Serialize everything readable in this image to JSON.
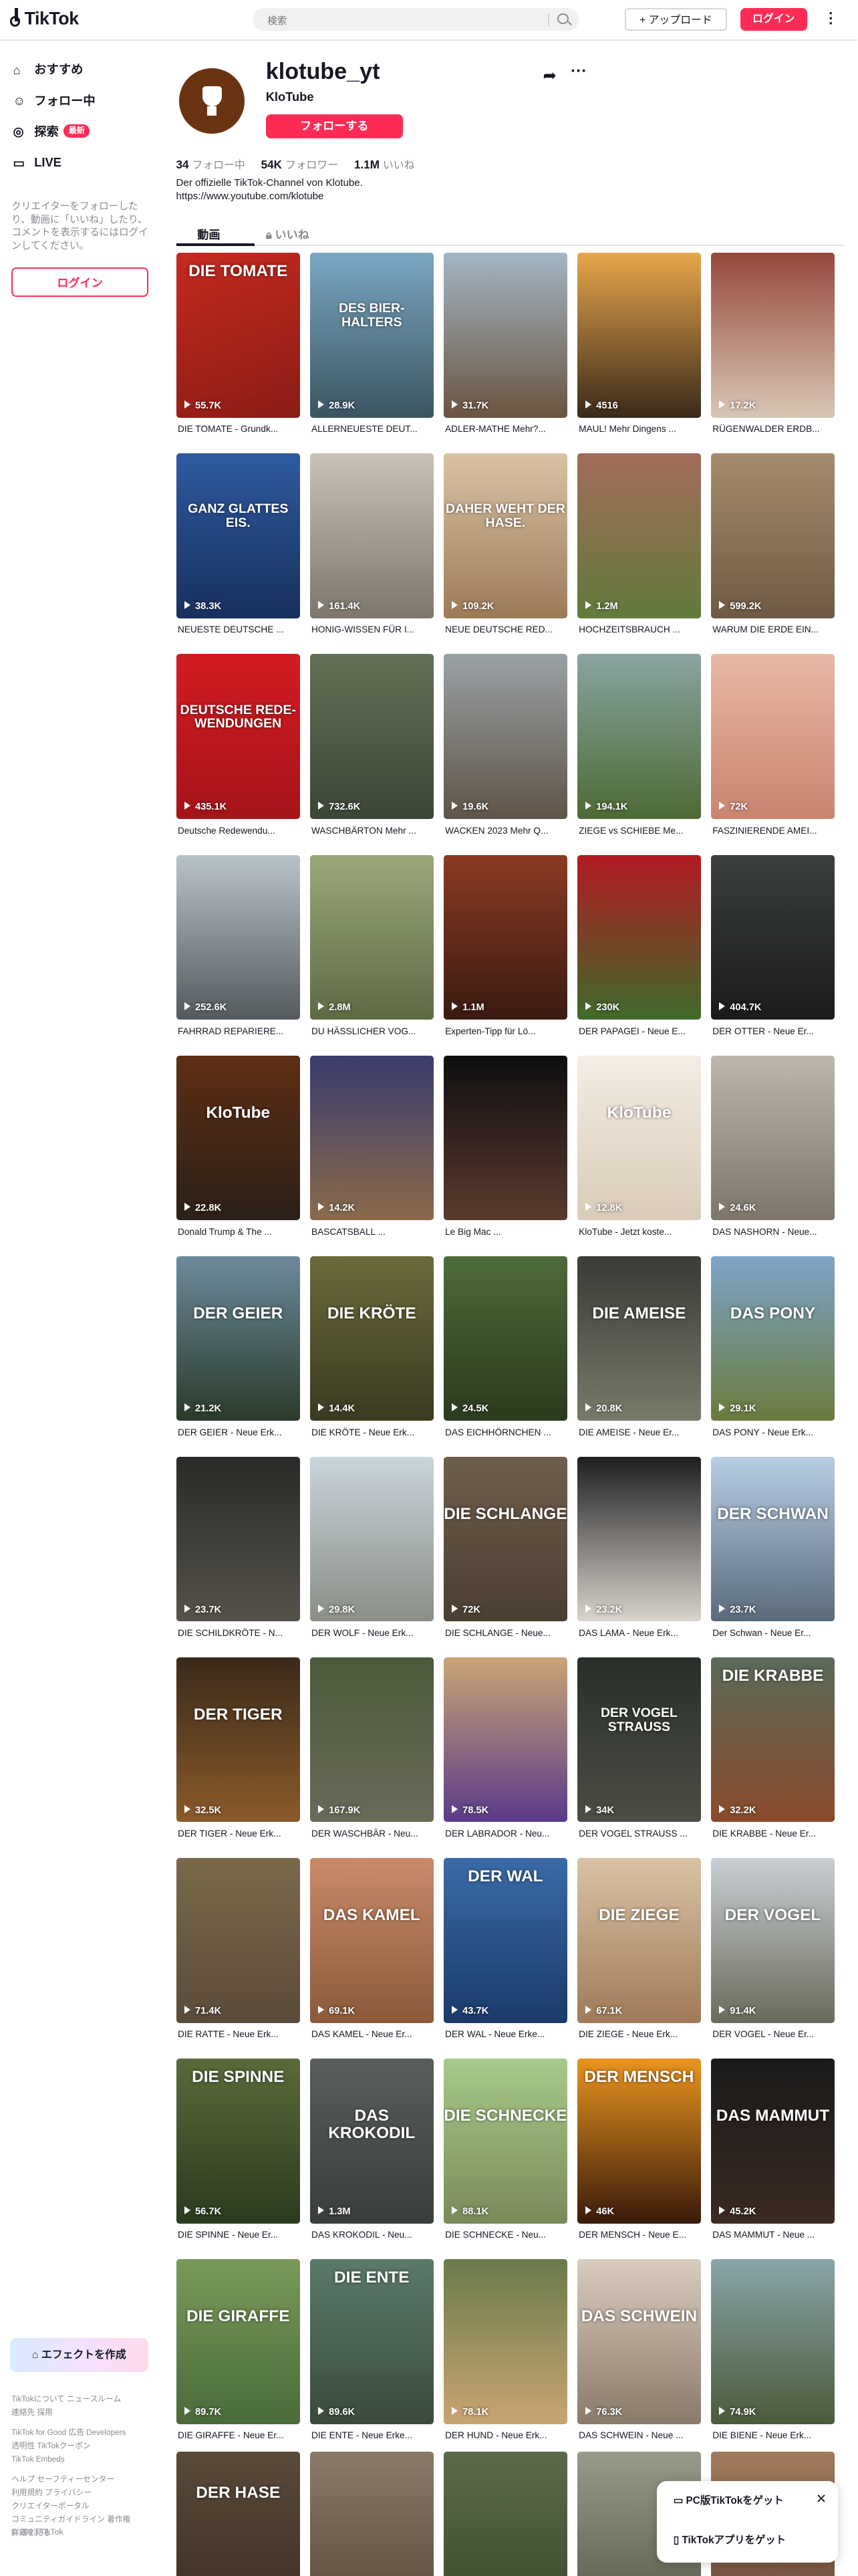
{
  "header": {
    "logo": "TikTok",
    "search_placeholder": "検索",
    "upload_label": "アップロード",
    "login_label": "ログイン"
  },
  "sidebar": {
    "items": [
      {
        "label": "おすすめ",
        "icon": "home-icon"
      },
      {
        "label": "フォロー中",
        "icon": "following-icon"
      },
      {
        "label": "探索",
        "icon": "compass-icon",
        "badge": "最新"
      },
      {
        "label": "LIVE",
        "icon": "live-icon"
      }
    ],
    "login_prompt": "クリエイターをフォローしたり、動画に「いいね」したり、コメントを表示するにはログインしてください。",
    "login_button": "ログイン",
    "effect_button": "エフェクトを作成",
    "footer_links": [
      "TikTokについて  ニュースルーム",
      "連絡先  採用",
      "TikTok for Good  広告  Developers",
      "透明性  TikTokクーポン",
      "TikTok Embeds",
      "ヘルプ  セーフティーセンター",
      "利用規約  プライバシー",
      "クリエイターポータル",
      "コミュニティガイドライン  著作権",
      "詳細を見る"
    ],
    "copyright": "© 2023 TikTok"
  },
  "profile": {
    "username": "klotube_yt",
    "nickname": "KloTube",
    "follow_button": "フォローする",
    "following_count": "34",
    "following_label": "フォロー中",
    "followers_count": "54K",
    "followers_label": "フォロワー",
    "likes_count": "1.1M",
    "likes_label": "いいね",
    "bio_line1": "Der offizielle TikTok-Channel von Klotube.",
    "bio_line2": "https://www.youtube.com/klotube",
    "tab_videos": "動画",
    "tab_likes": "いいね"
  },
  "videos": [
    {
      "views": "55.7K",
      "caption": "DIE TOMATE - Grundk...",
      "overlay": "DIE TOMATE",
      "bg": "linear-gradient(160deg,#c52a20,#8a1c15)"
    },
    {
      "views": "28.9K",
      "caption": "ALLERNEUESTE DEUT...",
      "overlay": "DES BIER-HALTERS",
      "bg": "linear-gradient(180deg,#7aa7c3,#3b5560)"
    },
    {
      "views": "31.7K",
      "caption": "ADLER-MATHE Mehr?...",
      "overlay": "",
      "bg": "linear-gradient(180deg,#a3b6c4,#6a5440)"
    },
    {
      "views": "4516",
      "caption": "MAUL! Mehr Dingens ...",
      "overlay": "",
      "bg": "linear-gradient(180deg,#e8a64b,#3a2a1a)"
    },
    {
      "views": "17.2K",
      "caption": "RÜGENWALDER ERDB...",
      "overlay": "",
      "bg": "linear-gradient(180deg,#96483c,#d9c7b6)"
    },
    {
      "views": "38.3K",
      "caption": "NEUESTE DEUTSCHE ...",
      "overlay": "GANZ GLATTES EIS.",
      "bg": "linear-gradient(180deg,#2e5aa0,#17305e)"
    },
    {
      "views": "161.4K",
      "caption": "HONIG-WISSEN FÜR I...",
      "overlay": "",
      "bg": "linear-gradient(180deg,#c9c2b6,#7c766c)"
    },
    {
      "views": "109.2K",
      "caption": "NEUE DEUTSCHE RED...",
      "overlay": "DAHER WEHT DER HASE.",
      "bg": "linear-gradient(180deg,#d9c3a4,#9c7a58)"
    },
    {
      "views": "1.2M",
      "caption": "HOCHZEITSBRAUCH ...",
      "overlay": "",
      "bg": "linear-gradient(180deg,#a36c5a,#617a3c)"
    },
    {
      "views": "599.2K",
      "caption": "WARUM DIE ERDE EIN...",
      "overlay": "",
      "bg": "linear-gradient(180deg,#a58c6c,#6e5a44)"
    },
    {
      "views": "435.1K",
      "caption": "Deutsche Redewendu...",
      "overlay": "DEUTSCHE REDE-WENDUNGEN",
      "bg": "linear-gradient(180deg,#d31c22,#a5141a)"
    },
    {
      "views": "732.6K",
      "caption": "WASCHBÄRTON Mehr ...",
      "overlay": "",
      "bg": "linear-gradient(180deg,#627056,#3c4636)"
    },
    {
      "views": "19.6K",
      "caption": "WACKEN 2023 Mehr Q...",
      "overlay": "",
      "bg": "linear-gradient(180deg,#9aa1a5,#5f5448)"
    },
    {
      "views": "194.1K",
      "caption": "ZIEGE vs SCHIEBE Me...",
      "overlay": "",
      "bg": "linear-gradient(180deg,#8aa4a0,#4d6a34)"
    },
    {
      "views": "72K",
      "caption": "FASZINIERENDE AMEI...",
      "overlay": "",
      "bg": "linear-gradient(180deg,#e8b8a6,#c9846e)"
    },
    {
      "views": "252.6K",
      "caption": "FAHRRAD REPARIERE...",
      "overlay": "",
      "bg": "linear-gradient(180deg,#b8c3c9,#545a5e)"
    },
    {
      "views": "2.8M",
      "caption": "DU HÄSSLICHER VOG...",
      "overlay": "",
      "bg": "linear-gradient(180deg,#9aa87a,#5e6a44)"
    },
    {
      "views": "1.1M",
      "caption": "Experten-Tipp für Lö...",
      "overlay": "",
      "bg": "linear-gradient(180deg,#8b3a22,#3a1a12)"
    },
    {
      "views": "230K",
      "caption": "DER PAPAGEI - Neue E...",
      "overlay": "",
      "bg": "linear-gradient(180deg,#b31a22,#3f6a2c)"
    },
    {
      "views": "404.7K",
      "caption": "DER OTTER - Neue Er...",
      "overlay": "",
      "bg": "linear-gradient(180deg,#3a3e3c,#1a1c1a)"
    },
    {
      "views": "22.8K",
      "caption": "Donald Trump & The ...",
      "overlay": "KloTube",
      "bg": "linear-gradient(180deg,#5e2e14,#2b2018)"
    },
    {
      "views": "14.2K",
      "caption": "BASCATSBALL ...",
      "overlay": "",
      "bg": "linear-gradient(180deg,#3a3c6e,#8a6a4a)"
    },
    {
      "views": "",
      "caption": "Le Big Mac ...",
      "overlay": "",
      "bg": "linear-gradient(180deg,#0e0e10,#5a3a2e)"
    },
    {
      "views": "12.8K",
      "caption": "KloTube - Jetzt koste...",
      "overlay": "KloTube",
      "bg": "linear-gradient(180deg,#f4ede4,#d9cbb8)"
    },
    {
      "views": "24.6K",
      "caption": "DAS NASHORN - Neue...",
      "overlay": "",
      "bg": "linear-gradient(180deg,#bcb6ac,#7d766a)"
    },
    {
      "views": "21.2K",
      "caption": "DER GEIER - Neue Erk...",
      "overlay": "DER GEIER",
      "bg": "linear-gradient(180deg,#6d8a9c,#2a3a2a)"
    },
    {
      "views": "14.4K",
      "caption": "DIE KRÖTE - Neue Erk...",
      "overlay": "DIE KRÖTE",
      "bg": "linear-gradient(180deg,#6b6a3a,#3a3a22)"
    },
    {
      "views": "24.5K",
      "caption": "DAS EICHHÖRNCHEN ...",
      "overlay": "",
      "bg": "linear-gradient(180deg,#4e6a3a,#2a3a1e)"
    },
    {
      "views": "20.8K",
      "caption": "DIE AMEISE - Neue Er...",
      "overlay": "DIE AMEISE",
      "bg": "linear-gradient(180deg,#3a3a36,#7a7a6a)"
    },
    {
      "views": "29.1K",
      "caption": "DAS PONY - Neue Erk...",
      "overlay": "DAS PONY",
      "bg": "linear-gradient(180deg,#7ea4c9,#6a7a3c)"
    },
    {
      "views": "23.7K",
      "caption": "DIE SCHILDKRÖTE - N...",
      "overlay": "",
      "bg": "linear-gradient(180deg,#2a2a28,#55524a)"
    },
    {
      "views": "29.8K",
      "caption": "DER WOLF - Neue Erk...",
      "overlay": "",
      "bg": "linear-gradient(180deg,#c9d4dc,#8a8e86)"
    },
    {
      "views": "72K",
      "caption": "DIE SCHLANGE - Neue...",
      "overlay": "DIE SCHLANGE",
      "bg": "linear-gradient(180deg,#6e5e4c,#4a3e32)"
    },
    {
      "views": "23.2K",
      "caption": "DAS LAMA - Neue Erk...",
      "overlay": "",
      "bg": "linear-gradient(180deg,#1e1e20,#d9d4cc)"
    },
    {
      "views": "23.7K",
      "caption": "Der Schwan - Neue Er...",
      "overlay": "DER SCHWAN",
      "bg": "linear-gradient(180deg,#b8cde4,#5a6a7a)"
    },
    {
      "views": "32.5K",
      "caption": "DER TIGER - Neue Erk...",
      "overlay": "DER TIGER",
      "bg": "linear-gradient(180deg,#3a2a1a,#8a5a2a)"
    },
    {
      "views": "167.9K",
      "caption": "DER WASCHBÄR - Neu...",
      "overlay": "",
      "bg": "linear-gradient(180deg,#4a5a3a,#6a6a5a)"
    },
    {
      "views": "78.5K",
      "caption": "DER LABRADOR - Neu...",
      "overlay": "",
      "bg": "linear-gradient(180deg,#c9a574,#5a3a8a)"
    },
    {
      "views": "34K",
      "caption": "DER VOGEL STRAUSS ...",
      "overlay": "DER VOGEL STRAUSS",
      "bg": "linear-gradient(180deg,#2a2e2a,#4a4e44)"
    },
    {
      "views": "32.2K",
      "caption": "DIE KRABBE - Neue Er...",
      "overlay": "DIE KRABBE",
      "bg": "linear-gradient(180deg,#5a6a5a,#8a4a2a)"
    },
    {
      "views": "71.4K",
      "caption": "DIE RATTE - Neue Erk...",
      "overlay": "",
      "bg": "linear-gradient(180deg,#7a6a4a,#5a4a3a)"
    },
    {
      "views": "69.1K",
      "caption": "DAS KAMEL - Neue Er...",
      "overlay": "DAS KAMEL",
      "bg": "linear-gradient(180deg,#c98a6a,#8a5a3a)"
    },
    {
      "views": "43.7K",
      "caption": "DER WAL - Neue Erke...",
      "overlay": "DER WAL",
      "bg": "linear-gradient(180deg,#3a6aa8,#1a3a6a)"
    },
    {
      "views": "67.1K",
      "caption": "DIE ZIEGE - Neue Erk...",
      "overlay": "DIE ZIEGE",
      "bg": "linear-gradient(180deg,#d9c3a4,#a07a5a)"
    },
    {
      "views": "91.4K",
      "caption": "DER VOGEL - Neue Er...",
      "overlay": "DER VOGEL",
      "bg": "linear-gradient(180deg,#c9cfd4,#6a6a5a)"
    },
    {
      "views": "56.7K",
      "caption": "DIE SPINNE - Neue Er...",
      "overlay": "DIE SPINNE",
      "bg": "linear-gradient(180deg,#5a6a3a,#2a3a1e)"
    },
    {
      "views": "1.3M",
      "caption": "DAS KROKODIL - Neu...",
      "overlay": "DAS KROKODIL",
      "bg": "linear-gradient(180deg,#5a5e5a,#3a3e3a)"
    },
    {
      "views": "88.1K",
      "caption": "DIE SCHNECKE - Neu...",
      "overlay": "DIE SCHNECKE",
      "bg": "linear-gradient(180deg,#a8c98a,#7a8a5a)"
    },
    {
      "views": "46K",
      "caption": "DER MENSCH - Neue E...",
      "overlay": "DER MENSCH",
      "bg": "linear-gradient(180deg,#e8941e,#3a1a0a)"
    },
    {
      "views": "45.2K",
      "caption": "DAS MAMMUT - Neue ...",
      "overlay": "DAS MAMMUT",
      "bg": "linear-gradient(180deg,#1a1a1a,#3a2a22)"
    },
    {
      "views": "89.7K",
      "caption": "DIE GIRAFFE - Neue Er...",
      "overlay": "DIE GIRAFFE",
      "bg": "linear-gradient(180deg,#7a9a5a,#4a6a3a)"
    },
    {
      "views": "89.6K",
      "caption": "DIE ENTE - Neue Erke...",
      "overlay": "DIE ENTE",
      "bg": "linear-gradient(180deg,#5a7a6a,#3a4a3a)"
    },
    {
      "views": "78.1K",
      "caption": "DER HUND - Neue Erk...",
      "overlay": "",
      "bg": "linear-gradient(180deg,#6a7a4a,#c9a574)"
    },
    {
      "views": "76.3K",
      "caption": "DAS SCHWEIN - Neue ...",
      "overlay": "DAS SCHWEIN",
      "bg": "linear-gradient(180deg,#d9cbbe,#8a7a6a)"
    },
    {
      "views": "74.9K",
      "caption": "DIE BIENE - Neue Erk...",
      "overlay": "",
      "bg": "linear-gradient(180deg,#8aa4a8,#4a5a3a)"
    }
  ],
  "partial_row": [
    {
      "overlay": "DER HASE",
      "bg": "linear-gradient(180deg,#5a4a3a,#3a2e22)"
    },
    {
      "overlay": "",
      "bg": "linear-gradient(180deg,#8a7a6a,#5a4a3a)"
    },
    {
      "overlay": "",
      "bg": "linear-gradient(180deg,#5a6a4a,#3a4a2e)"
    },
    {
      "overlay": "",
      "bg": "linear-gradient(180deg,#9a9a8a,#5a5a4a)"
    },
    {
      "overlay": "KloTube",
      "bg": "linear-gradient(180deg,#a07a5a,#6a4a3a)"
    }
  ],
  "popup": {
    "pc_label": "PC版TikTokをゲット",
    "app_label": "TikTokアプリをゲット"
  },
  "colors": {
    "accent": "#fe2c55",
    "text": "#161823",
    "muted": "#8a8b91"
  }
}
